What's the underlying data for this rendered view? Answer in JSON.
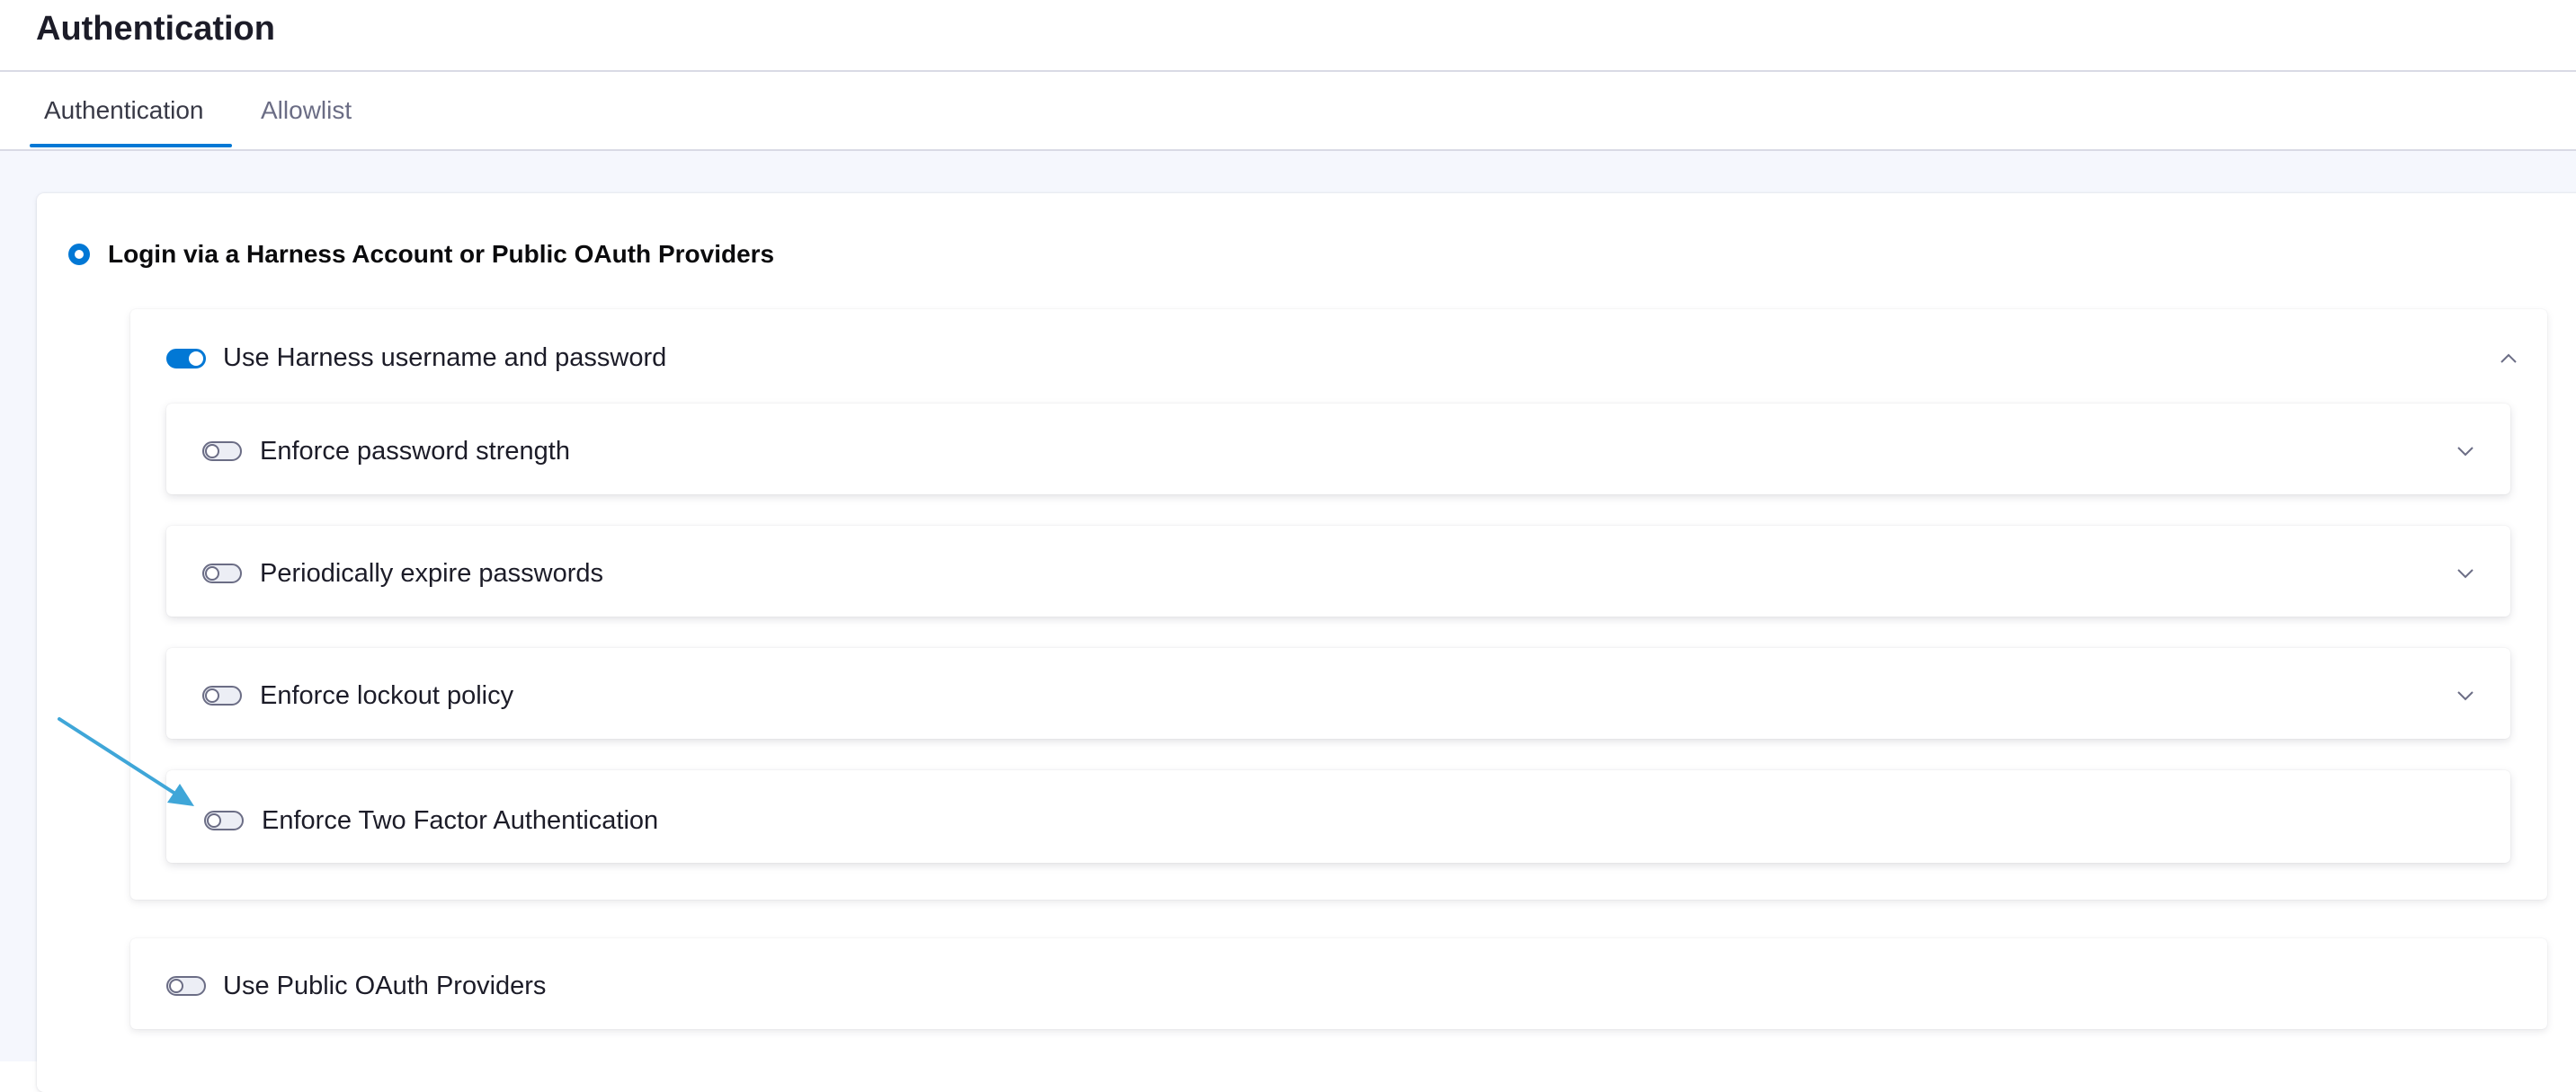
{
  "header": {
    "title": "Authentication"
  },
  "tabs": [
    {
      "label": "Authentication",
      "active": true
    },
    {
      "label": "Allowlist",
      "active": false
    }
  ],
  "login_option": {
    "label": "Login via a Harness Account or Public OAuth Providers",
    "selected": true
  },
  "harness_account": {
    "label": "Use Harness username and password",
    "enabled": true,
    "expanded": true,
    "settings": [
      {
        "label": "Enforce password strength",
        "enabled": false
      },
      {
        "label": "Periodically expire passwords",
        "enabled": false
      },
      {
        "label": "Enforce lockout policy",
        "enabled": false
      },
      {
        "label": "Enforce Two Factor Authentication",
        "enabled": false
      }
    ]
  },
  "oauth": {
    "label": "Use Public OAuth Providers",
    "enabled": false
  },
  "colors": {
    "accent": "#0278d5",
    "annotation_arrow": "#3fa6d8",
    "background": "#f5f7fd"
  }
}
